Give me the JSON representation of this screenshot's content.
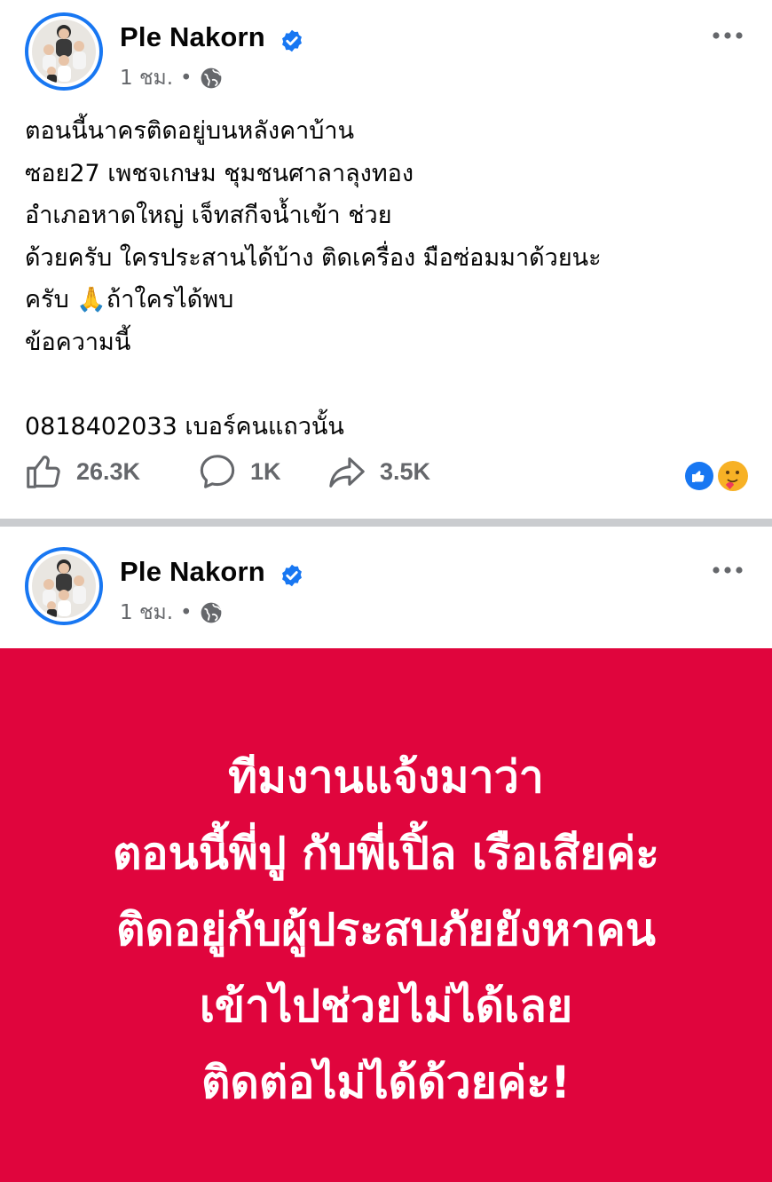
{
  "posts": [
    {
      "author": "Ple Nakorn",
      "time": "1 ชม.",
      "separator": "•",
      "body": "ตอนนี้นาครติดอยู่บนหลังคาบ้าน\nซอย27 เพชจเกษม ชุมชนศาลาลุงทอง\nอำเภอหาดใหญ่ เจ็ทสกีจน้ำเข้า ช่วย\nด้วยครับ ใครประสานได้บ้าง ติดเครื่อง มือซ่อมมาด้วยนะ\nครับ 🙏ถ้าใครได้พบ\nข้อความนี้\n\n0818402033 เบอร์คนแถวนั้น",
      "likes": "26.3K",
      "comments": "1K",
      "shares": "3.5K"
    },
    {
      "author": "Ple Nakorn",
      "time": "1 ชม.",
      "separator": "•",
      "banner_text": "ทีมงานแจ้งมาว่า\nตอนนี้พี่ปู กับพี่เปิ้ล เรือเสียค่ะ\nติดอยู่กับผู้ประสบภัยยังหาคน\nเข้าไปช่วยไม่ได้เลย\nติดต่อไม่ได้ด้วยค่ะ!",
      "banner_color": "#e0053d"
    }
  ],
  "icons": {
    "verified": "verified-badge-icon",
    "audience": "globe-icon",
    "more": "more-options-icon",
    "like": "like-icon",
    "comment": "comment-icon",
    "share": "share-icon"
  },
  "colors": {
    "verified_blue": "#1877f2",
    "meta_gray": "#65676b",
    "divider": "#cacccf"
  }
}
